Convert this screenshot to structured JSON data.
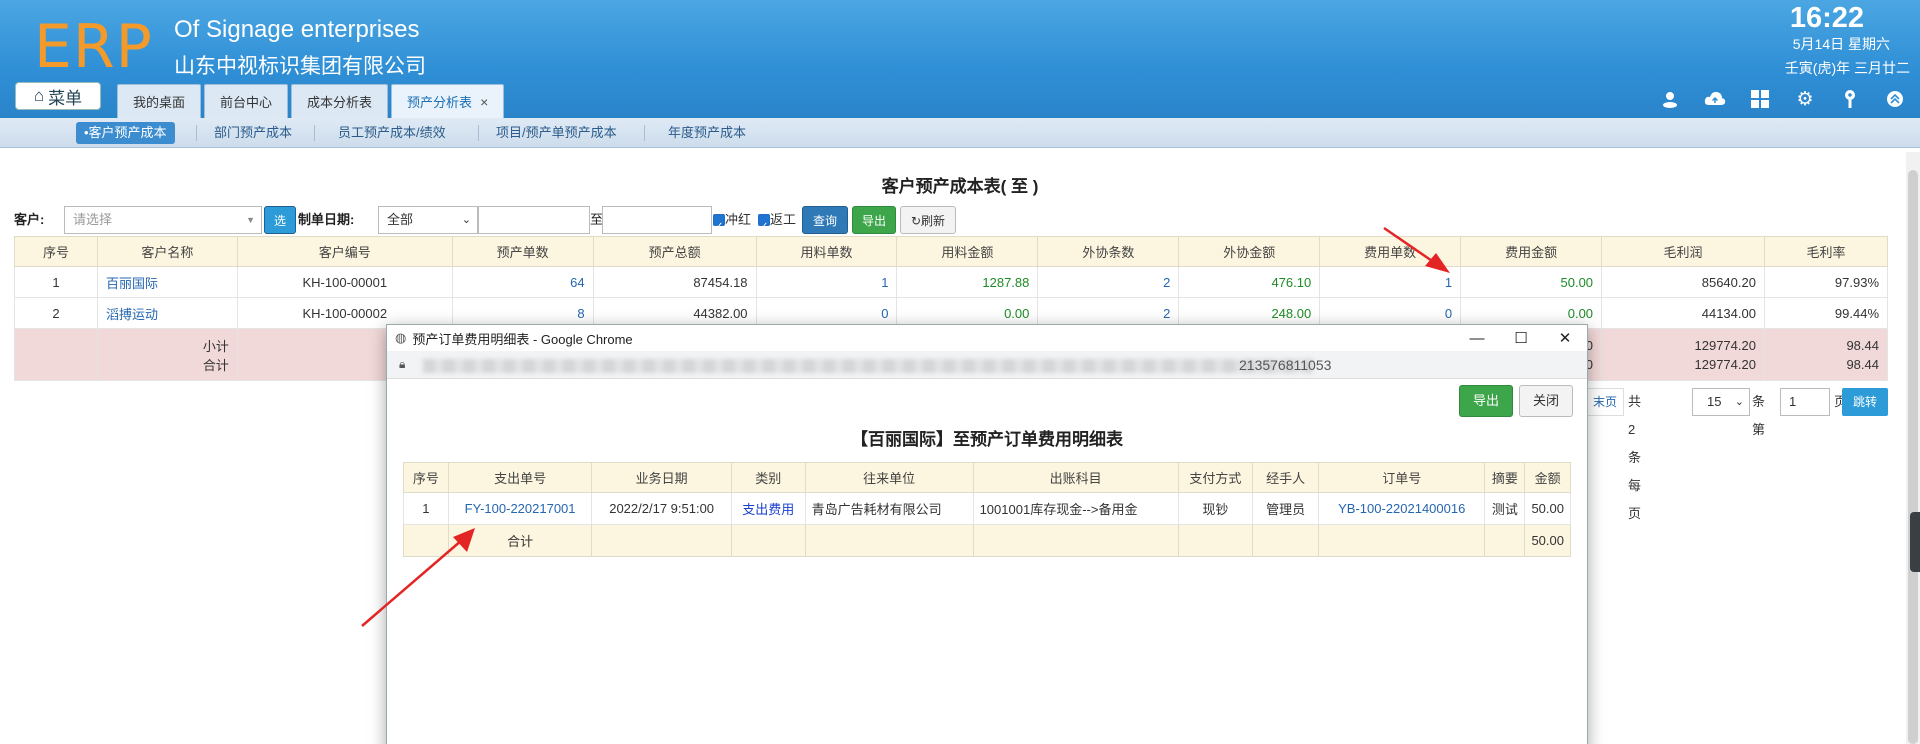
{
  "header": {
    "logo": "ERP",
    "company_en": "Of Signage enterprises",
    "company_cn": "山东中视标识集团有限公司",
    "time": "16:22",
    "date": "5月14日 星期六",
    "lunar": "壬寅(虎)年 三月廿二",
    "menu_label": "菜单",
    "tabs": [
      {
        "label": "我的桌面"
      },
      {
        "label": "前台中心"
      },
      {
        "label": "成本分析表"
      },
      {
        "label": "预产分析表",
        "closable": "×"
      }
    ],
    "tool_icons": [
      "user-icon",
      "cloud-icon",
      "apps-icon",
      "gear-icon",
      "key-icon",
      "collapse-icon"
    ]
  },
  "subnav": [
    {
      "label": "•客户预产成本"
    },
    {
      "label": "部门预产成本"
    },
    {
      "label": "员工预产成本/绩效"
    },
    {
      "label": "项目/预产单预产成本"
    },
    {
      "label": "年度预产成本"
    }
  ],
  "page": {
    "title": "客户预产成本表( 至 )",
    "filters": {
      "customer_label": "客户:",
      "customer_placeholder": "请选择",
      "select_btn": "选",
      "date_label": "制单日期:",
      "date_range": "全部",
      "to": "至",
      "chk1": "冲红",
      "chk2": "返工",
      "query": "查询",
      "export": "导出",
      "refresh": "刷新"
    },
    "columns": [
      "序号",
      "客户名称",
      "客户编号",
      "预产单数",
      "预产总额",
      "用料单数",
      "用料金额",
      "外协条数",
      "外协金额",
      "费用单数",
      "费用金额",
      "毛利润",
      "毛利率"
    ],
    "rows": [
      {
        "no": "1",
        "name": "百丽国际",
        "code": "KH-100-00001",
        "orders": "64",
        "total": "87454.18",
        "mat_cnt": "1",
        "mat_amt": "1287.88",
        "out_cnt": "2",
        "out_amt": "476.10",
        "fee_cnt": "1",
        "fee_amt": "50.00",
        "profit": "85640.20",
        "rate": "97.93%"
      },
      {
        "no": "2",
        "name": "滔搏运动",
        "code": "KH-100-00002",
        "orders": "8",
        "total": "44382.00",
        "mat_cnt": "0",
        "mat_amt": "0.00",
        "out_cnt": "2",
        "out_amt": "248.00",
        "fee_cnt": "0",
        "fee_amt": "0.00",
        "profit": "44134.00",
        "rate": "99.44%"
      }
    ],
    "subtotal_label": "小计",
    "total_label": "合计",
    "subtotal": {
      "fee_amt": "00",
      "profit": "129774.20",
      "rate": "98.44"
    },
    "total": {
      "fee_amt": "00",
      "profit": "129774.20",
      "rate": "98.44"
    },
    "pager": {
      "last": "末页",
      "summary": "共2条每页",
      "per_page": "15",
      "unit": "条第",
      "page": "1",
      "page_unit": "页",
      "jump": "跳转"
    }
  },
  "popup": {
    "window_title": "预产订单费用明细表 - Google Chrome",
    "url_tail": "213576811053",
    "export": "导出",
    "close": "关闭",
    "title": "【百丽国际】至预产订单费用明细表",
    "columns": [
      "序号",
      "支出单号",
      "业务日期",
      "类别",
      "往来单位",
      "出账科目",
      "支付方式",
      "经手人",
      "订单号",
      "摘要",
      "金额"
    ],
    "rows": [
      {
        "no": "1",
        "doc": "FY-100-220217001",
        "date": "2022/2/17 9:51:00",
        "type": "支出费用",
        "party": "青岛广告耗材有限公司",
        "account": "1001001库存现金-->备用金",
        "pay": "现钞",
        "handler": "管理员",
        "order": "YB-100-22021400016",
        "memo": "测试",
        "amount": "50.00"
      }
    ],
    "total_label": "合计",
    "total_amount": "50.00"
  }
}
